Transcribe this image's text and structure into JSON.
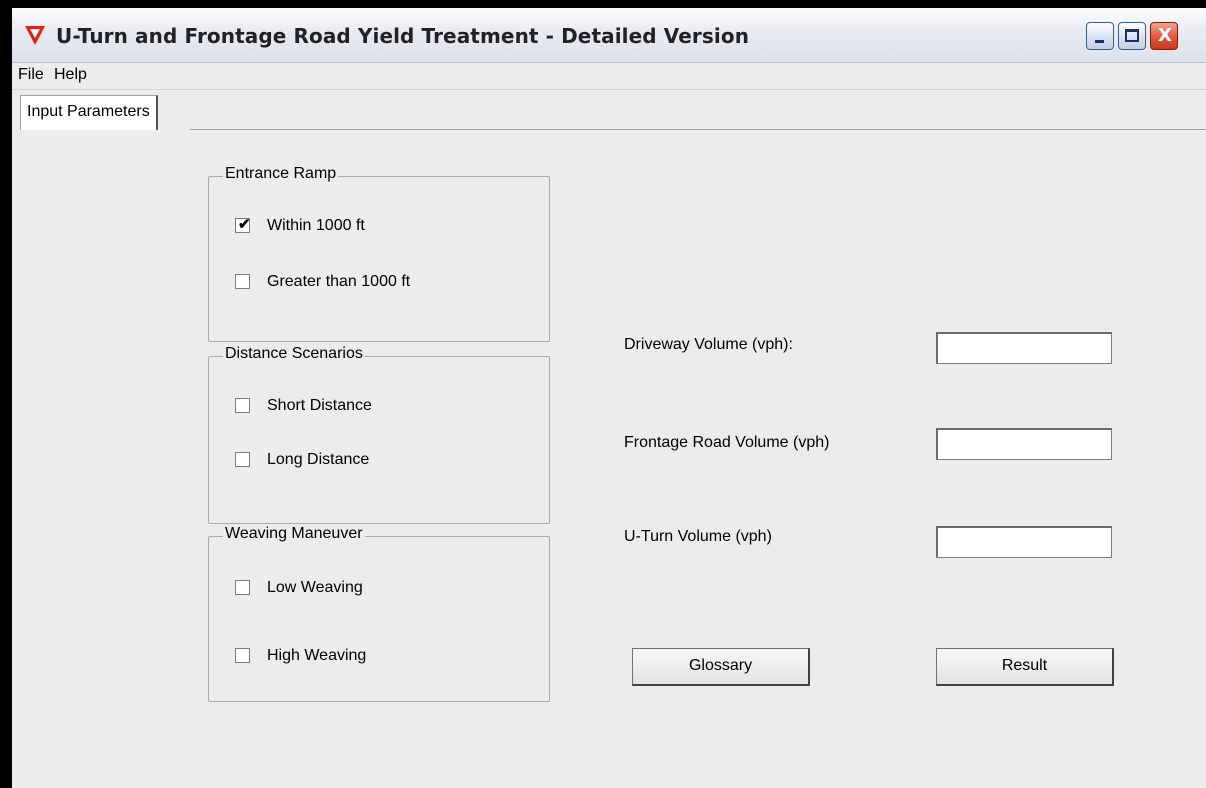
{
  "window": {
    "title": "U-Turn and Frontage Road Yield Treatment - Detailed Version",
    "icon": "red-triangle-yield-icon",
    "controls": {
      "minimize": "minimize",
      "maximize": "maximize",
      "close": "X"
    }
  },
  "menu": {
    "items": [
      "File",
      "Help"
    ]
  },
  "tabs": [
    {
      "label": "Input Parameters",
      "selected": true
    }
  ],
  "groups": {
    "entrance_ramp": {
      "title": "Entrance Ramp",
      "options": [
        {
          "label": "Within 1000 ft",
          "checked": true
        },
        {
          "label": "Greater than 1000 ft",
          "checked": false
        }
      ]
    },
    "distance_scenarios": {
      "title": "Distance Scenarios",
      "options": [
        {
          "label": "Short Distance",
          "checked": false
        },
        {
          "label": "Long Distance",
          "checked": false
        }
      ]
    },
    "weaving_maneuver": {
      "title": "Weaving Maneuver",
      "options": [
        {
          "label": "Low Weaving",
          "checked": false
        },
        {
          "label": "High Weaving",
          "checked": false
        }
      ]
    }
  },
  "fields": {
    "driveway_volume": {
      "label": "Driveway Volume (vph):",
      "value": ""
    },
    "frontage_road_volume": {
      "label": "Frontage Road Volume (vph)",
      "value": ""
    },
    "uturn_volume": {
      "label": "U-Turn Volume (vph)",
      "value": ""
    }
  },
  "buttons": {
    "glossary": "Glossary",
    "result": "Result"
  },
  "colors": {
    "titlebar": "#e7ebf2",
    "panel": "#ececec",
    "close_button": "#e4553a",
    "app_icon": "#d9261c"
  }
}
